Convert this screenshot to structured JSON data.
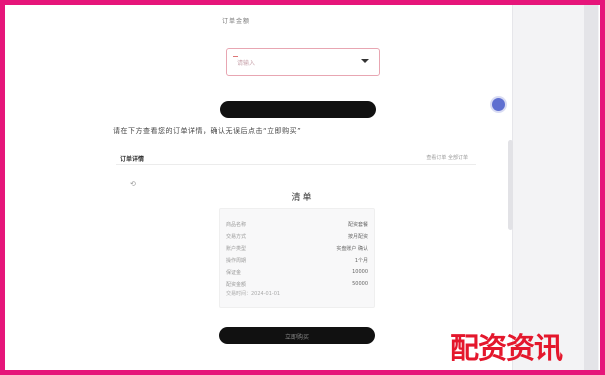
{
  "form": {
    "small_label": "订单金额",
    "field_placeholder": "请输入",
    "submit_label": ""
  },
  "notice": "请在下方查看您的订单详情，确认无误后点击“立即购买”",
  "toolbar": {
    "left": "订单详情",
    "right": "查看订单 全部订单",
    "icon": "⟲"
  },
  "card": {
    "title": "清单",
    "rows": [
      {
        "k": "商品名称",
        "v": "配资套餐"
      },
      {
        "k": "交易方式",
        "v": "按月配资"
      },
      {
        "k": "账户类型",
        "v": "实盘账户 确认"
      },
      {
        "k": "操作周期",
        "v": "1个月"
      },
      {
        "k": "保证金",
        "v": "10000"
      },
      {
        "k": "配资金额",
        "v": "50000"
      }
    ],
    "footer": "交易时间：2024-01-01"
  },
  "bottom_button": "立即购买",
  "watermark": "配资资讯",
  "colors": {
    "frame": "#e6157a",
    "button": "#111111",
    "fab": "#5f6fd0",
    "watermark": "#e4172c"
  }
}
